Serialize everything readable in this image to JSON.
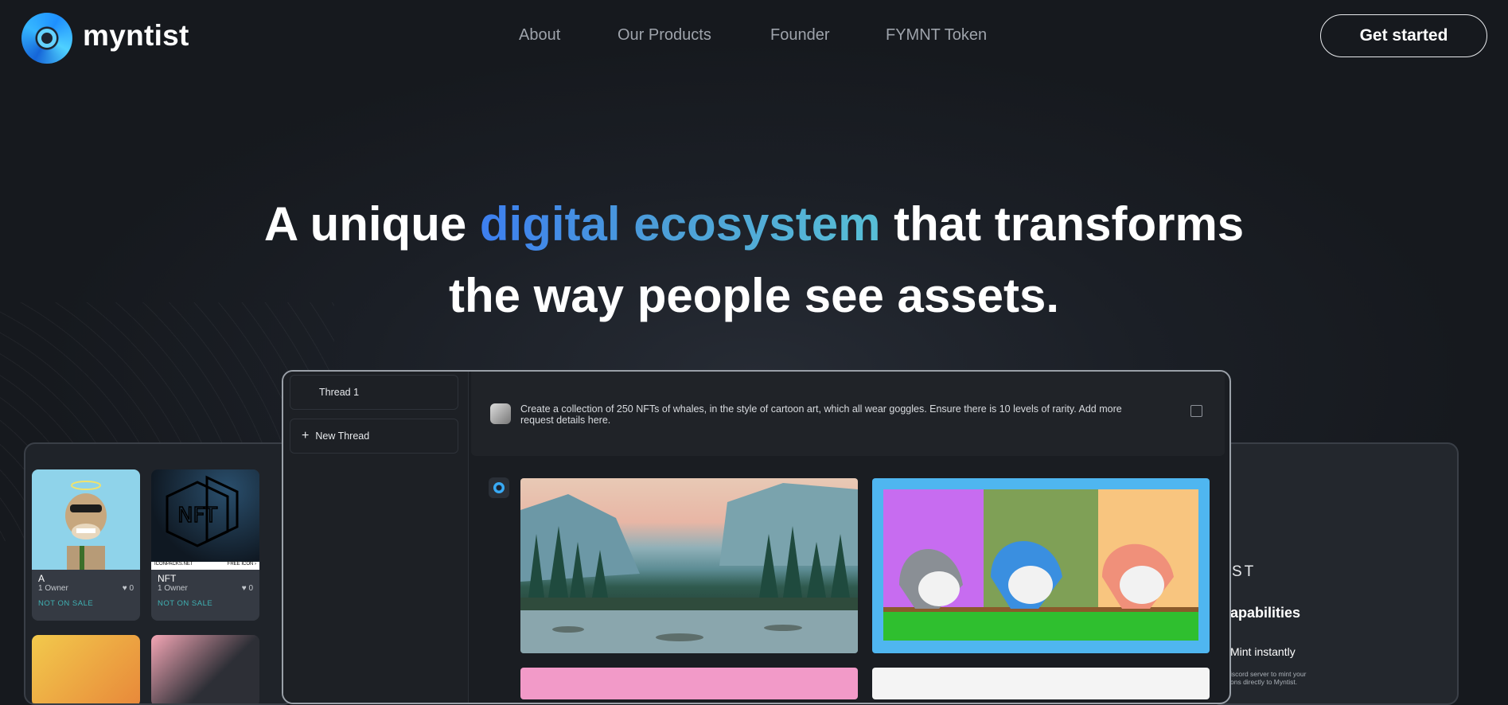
{
  "brand": {
    "name": "myntist"
  },
  "nav": {
    "items": [
      "About",
      "Our Products",
      "Founder",
      "FYMNT Token"
    ]
  },
  "header": {
    "cta_label": "Get started"
  },
  "hero": {
    "line1_before": "A unique ",
    "line1_highlight": "digital ecosystem",
    "line1_after": " that transforms",
    "line2": "the way people see assets."
  },
  "app": {
    "threads": [
      {
        "label": "Thread 1"
      },
      {
        "label": "New Thread",
        "icon": "plus-icon"
      }
    ],
    "prompt": "Create a collection of 250 NFTs of whales, in the style of cartoon art, which all wear goggles. Ensure there is 10 levels of rarity. Add more request details here."
  },
  "left_cards": [
    {
      "title": "A",
      "owner": "1 Owner",
      "likes": "0",
      "status": "NOT ON SALE"
    },
    {
      "title": "NFT",
      "owner": "1 Owner",
      "likes": "0",
      "status": "NOT ON SALE",
      "banner_left": "ICONPACKS.NET",
      "banner_right": "FREE ICON ›",
      "art_text": "NFT"
    }
  ],
  "right_panel": {
    "brand_fragment": "ST",
    "heading": "apabilities",
    "item": "Mint instantly",
    "desc": "iscord server to mint your\nons directly to Myntist."
  },
  "colors": {
    "accent_blue": "#3d7ff0",
    "accent_teal": "#58bfd6",
    "whale_frame": "#4fb6f0"
  }
}
